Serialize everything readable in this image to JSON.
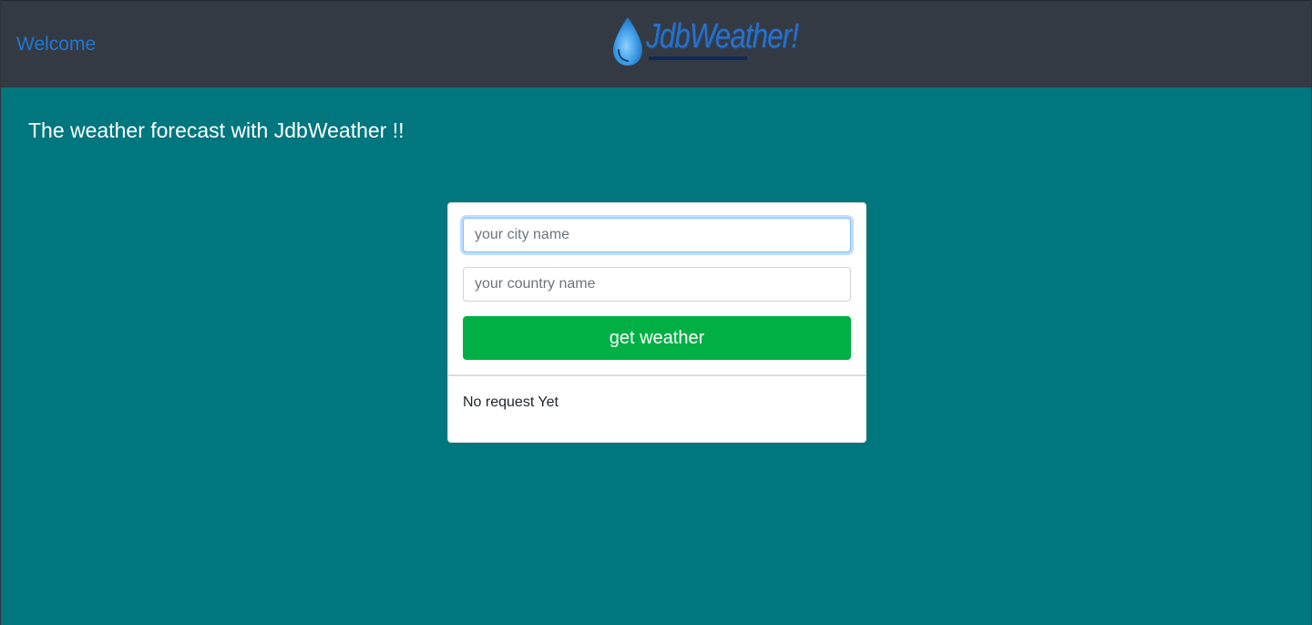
{
  "navbar": {
    "welcome_label": "Welcome",
    "logo_text": "JdbWeather!",
    "logo_icon": "water-drop-icon",
    "background": "#343a43",
    "link_color": "#1f78d1"
  },
  "main": {
    "title": "The weather forecast with JdbWeather !!",
    "background": "#00767f"
  },
  "form": {
    "city_placeholder": "your city name",
    "city_value": "",
    "country_placeholder": "your country name",
    "country_value": "",
    "submit_label": "get weather",
    "submit_color": "#00b045"
  },
  "result": {
    "status_text": "No request Yet"
  }
}
